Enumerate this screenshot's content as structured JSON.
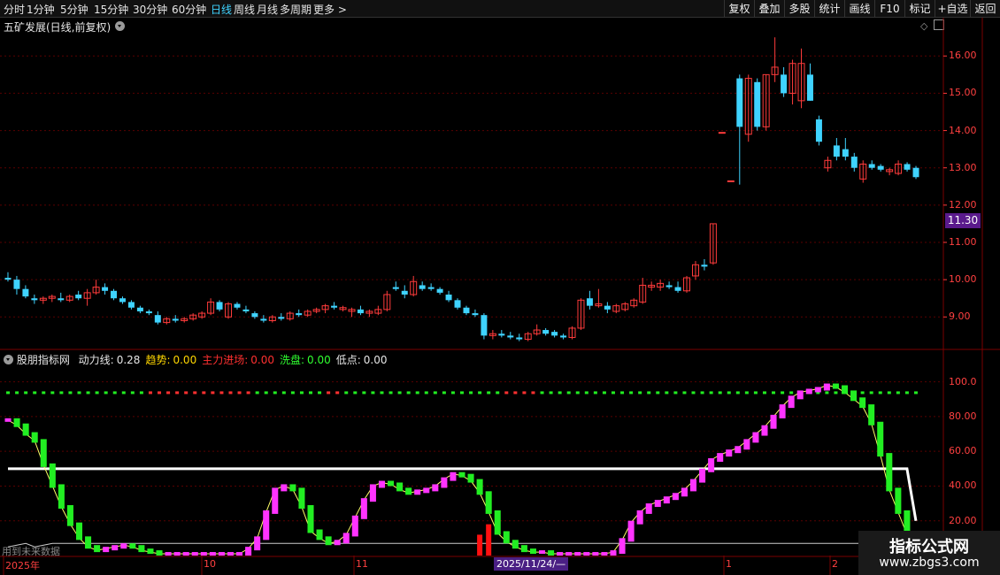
{
  "toolbar": {
    "timeframes": [
      {
        "label": "分时",
        "active": false
      },
      {
        "label": "1分钟",
        "active": false
      },
      {
        "label": "5分钟",
        "active": false
      },
      {
        "label": "15分钟",
        "active": false
      },
      {
        "label": "30分钟",
        "active": false
      },
      {
        "label": "60分钟",
        "active": false
      },
      {
        "label": "日线",
        "active": true
      },
      {
        "label": "周线",
        "active": false
      },
      {
        "label": "月线",
        "active": false
      },
      {
        "label": "多周期",
        "active": false
      },
      {
        "label": "更多 >",
        "active": false
      }
    ],
    "buttons": [
      "复权",
      "叠加",
      "多股",
      "统计",
      "画线",
      "F10",
      "标记",
      "+自选",
      "返回"
    ]
  },
  "main_panel": {
    "title": "五矿发展(日线,前复权)",
    "y_labels": [
      "16.00",
      "15.00",
      "14.00",
      "13.00",
      "12.00",
      "11.00",
      "10.00",
      "9.00"
    ],
    "current_price": "11.30"
  },
  "indicator_panel": {
    "name": "股朋指标网",
    "fields": [
      {
        "label": "动力线:",
        "value": "0.28",
        "label_color": "#e6e6e6",
        "value_color": "#e6e6e6"
      },
      {
        "label": "趋势:",
        "value": "0.00",
        "label_color": "#ffd700",
        "value_color": "#ffd700"
      },
      {
        "label": "主力进场:",
        "value": "0.00",
        "label_color": "#ff3030",
        "value_color": "#ff3030"
      },
      {
        "label": "洗盘:",
        "value": "0.00",
        "label_color": "#30ff30",
        "value_color": "#30ff30"
      },
      {
        "label": "低点:",
        "value": "0.00",
        "label_color": "#e6e6e6",
        "value_color": "#e6e6e6"
      }
    ],
    "y_labels": [
      "100.0",
      "80.00",
      "60.00",
      "40.00",
      "20.00"
    ]
  },
  "x_axis": {
    "labels": [
      {
        "text": "2025年"
      },
      {
        "text": "10"
      },
      {
        "text": "11"
      },
      {
        "text": "1"
      },
      {
        "text": "2"
      }
    ],
    "cursor_date": "2025/11/24/—"
  },
  "watermark": {
    "left_text": "用到未来数据",
    "brand": "指标公式网",
    "url": "www.zbgs3.com"
  },
  "colors": {
    "up": "#ff3b3b",
    "down": "#3fd3ff",
    "grid": "#7a0000",
    "accent": "#5a1a8c",
    "magenta": "#ff33ff",
    "green": "#22ee22"
  },
  "chart_data": [
    {
      "type": "candlestick",
      "y_range": [
        8.2,
        16.6
      ],
      "candles": [
        {
          "o": 10.05,
          "h": 10.2,
          "l": 9.95,
          "c": 10.0
        },
        {
          "o": 10.0,
          "h": 10.1,
          "l": 9.6,
          "c": 9.75
        },
        {
          "o": 9.75,
          "h": 9.85,
          "l": 9.5,
          "c": 9.55
        },
        {
          "o": 9.5,
          "h": 9.6,
          "l": 9.35,
          "c": 9.45
        },
        {
          "o": 9.45,
          "h": 9.55,
          "l": 9.35,
          "c": 9.5
        },
        {
          "o": 9.5,
          "h": 9.6,
          "l": 9.4,
          "c": 9.55
        },
        {
          "o": 9.5,
          "h": 9.65,
          "l": 9.4,
          "c": 9.45
        },
        {
          "o": 9.45,
          "h": 9.6,
          "l": 9.4,
          "c": 9.55
        },
        {
          "o": 9.6,
          "h": 9.7,
          "l": 9.45,
          "c": 9.5
        },
        {
          "o": 9.5,
          "h": 9.75,
          "l": 9.3,
          "c": 9.65
        },
        {
          "o": 9.65,
          "h": 10.0,
          "l": 9.6,
          "c": 9.8
        },
        {
          "o": 9.8,
          "h": 9.9,
          "l": 9.6,
          "c": 9.7
        },
        {
          "o": 9.7,
          "h": 9.75,
          "l": 9.45,
          "c": 9.5
        },
        {
          "o": 9.5,
          "h": 9.55,
          "l": 9.35,
          "c": 9.4
        },
        {
          "o": 9.4,
          "h": 9.45,
          "l": 9.2,
          "c": 9.25
        },
        {
          "o": 9.25,
          "h": 9.3,
          "l": 9.1,
          "c": 9.15
        },
        {
          "o": 9.15,
          "h": 9.2,
          "l": 9.05,
          "c": 9.1
        },
        {
          "o": 9.05,
          "h": 9.15,
          "l": 8.8,
          "c": 8.85
        },
        {
          "o": 8.85,
          "h": 9.0,
          "l": 8.8,
          "c": 8.95
        },
        {
          "o": 8.95,
          "h": 9.05,
          "l": 8.85,
          "c": 8.9
        },
        {
          "o": 8.9,
          "h": 9.0,
          "l": 8.85,
          "c": 8.95
        },
        {
          "o": 8.95,
          "h": 9.1,
          "l": 8.9,
          "c": 9.05
        },
        {
          "o": 9.0,
          "h": 9.15,
          "l": 8.95,
          "c": 9.1
        },
        {
          "o": 9.1,
          "h": 9.5,
          "l": 9.05,
          "c": 9.4
        },
        {
          "o": 9.4,
          "h": 9.45,
          "l": 9.15,
          "c": 9.2
        },
        {
          "o": 9.0,
          "h": 9.4,
          "l": 8.95,
          "c": 9.35
        },
        {
          "o": 9.35,
          "h": 9.4,
          "l": 9.2,
          "c": 9.25
        },
        {
          "o": 9.2,
          "h": 9.3,
          "l": 9.1,
          "c": 9.15
        },
        {
          "o": 9.1,
          "h": 9.15,
          "l": 8.95,
          "c": 9.0
        },
        {
          "o": 8.95,
          "h": 9.05,
          "l": 8.85,
          "c": 8.9
        },
        {
          "o": 8.9,
          "h": 9.05,
          "l": 8.85,
          "c": 9.0
        },
        {
          "o": 9.0,
          "h": 9.1,
          "l": 8.9,
          "c": 8.95
        },
        {
          "o": 8.95,
          "h": 9.15,
          "l": 8.9,
          "c": 9.1
        },
        {
          "o": 9.1,
          "h": 9.2,
          "l": 9.0,
          "c": 9.05
        },
        {
          "o": 9.05,
          "h": 9.2,
          "l": 9.0,
          "c": 9.15
        },
        {
          "o": 9.15,
          "h": 9.25,
          "l": 9.1,
          "c": 9.2
        },
        {
          "o": 9.2,
          "h": 9.35,
          "l": 9.1,
          "c": 9.3
        },
        {
          "o": 9.3,
          "h": 9.4,
          "l": 9.2,
          "c": 9.25
        },
        {
          "o": 9.2,
          "h": 9.3,
          "l": 9.15,
          "c": 9.25
        },
        {
          "o": 9.15,
          "h": 9.25,
          "l": 9.0,
          "c": 9.2
        },
        {
          "o": 9.2,
          "h": 9.3,
          "l": 9.05,
          "c": 9.1
        },
        {
          "o": 9.1,
          "h": 9.2,
          "l": 9.0,
          "c": 9.15
        },
        {
          "o": 9.1,
          "h": 9.3,
          "l": 9.05,
          "c": 9.2
        },
        {
          "o": 9.2,
          "h": 9.7,
          "l": 9.15,
          "c": 9.6
        },
        {
          "o": 9.8,
          "h": 9.95,
          "l": 9.7,
          "c": 9.75
        },
        {
          "o": 9.7,
          "h": 9.85,
          "l": 9.5,
          "c": 9.6
        },
        {
          "o": 9.6,
          "h": 10.1,
          "l": 9.55,
          "c": 9.95
        },
        {
          "o": 9.85,
          "h": 9.95,
          "l": 9.7,
          "c": 9.75
        },
        {
          "o": 9.8,
          "h": 9.9,
          "l": 9.7,
          "c": 9.75
        },
        {
          "o": 9.75,
          "h": 9.8,
          "l": 9.6,
          "c": 9.65
        },
        {
          "o": 9.6,
          "h": 9.7,
          "l": 9.4,
          "c": 9.45
        },
        {
          "o": 9.45,
          "h": 9.5,
          "l": 9.2,
          "c": 9.25
        },
        {
          "o": 9.25,
          "h": 9.3,
          "l": 9.05,
          "c": 9.1
        },
        {
          "o": 9.1,
          "h": 9.2,
          "l": 9.0,
          "c": 9.05
        },
        {
          "o": 9.05,
          "h": 9.1,
          "l": 8.4,
          "c": 8.5
        },
        {
          "o": 8.5,
          "h": 8.65,
          "l": 8.4,
          "c": 8.55
        },
        {
          "o": 8.55,
          "h": 8.65,
          "l": 8.45,
          "c": 8.5
        },
        {
          "o": 8.5,
          "h": 8.6,
          "l": 8.4,
          "c": 8.45
        },
        {
          "o": 8.45,
          "h": 8.55,
          "l": 8.35,
          "c": 8.4
        },
        {
          "o": 8.4,
          "h": 8.6,
          "l": 8.35,
          "c": 8.55
        },
        {
          "o": 8.55,
          "h": 8.8,
          "l": 8.5,
          "c": 8.65
        },
        {
          "o": 8.65,
          "h": 8.7,
          "l": 8.5,
          "c": 8.55
        },
        {
          "o": 8.6,
          "h": 8.65,
          "l": 8.45,
          "c": 8.5
        },
        {
          "o": 8.5,
          "h": 8.55,
          "l": 8.4,
          "c": 8.45
        },
        {
          "o": 8.45,
          "h": 8.75,
          "l": 8.4,
          "c": 8.7
        },
        {
          "o": 8.7,
          "h": 9.5,
          "l": 8.65,
          "c": 9.45
        },
        {
          "o": 9.5,
          "h": 9.7,
          "l": 9.2,
          "c": 9.3
        },
        {
          "o": 9.3,
          "h": 9.75,
          "l": 9.25,
          "c": 9.35
        },
        {
          "o": 9.3,
          "h": 9.4,
          "l": 9.1,
          "c": 9.2
        },
        {
          "o": 9.15,
          "h": 9.35,
          "l": 9.1,
          "c": 9.3
        },
        {
          "o": 9.2,
          "h": 9.4,
          "l": 9.15,
          "c": 9.35
        },
        {
          "o": 9.3,
          "h": 9.5,
          "l": 9.25,
          "c": 9.45
        },
        {
          "o": 9.4,
          "h": 10.05,
          "l": 9.35,
          "c": 9.85
        },
        {
          "o": 9.8,
          "h": 9.95,
          "l": 9.7,
          "c": 9.85
        },
        {
          "o": 9.8,
          "h": 10.0,
          "l": 9.7,
          "c": 9.9
        },
        {
          "o": 9.85,
          "h": 9.95,
          "l": 9.75,
          "c": 9.8
        },
        {
          "o": 9.8,
          "h": 9.95,
          "l": 9.65,
          "c": 9.7
        },
        {
          "o": 9.7,
          "h": 10.1,
          "l": 9.65,
          "c": 10.05
        },
        {
          "o": 10.1,
          "h": 10.5,
          "l": 10.0,
          "c": 10.4
        },
        {
          "o": 10.4,
          "h": 10.55,
          "l": 10.25,
          "c": 10.35
        },
        {
          "o": 10.45,
          "h": 11.5,
          "l": 10.4,
          "c": 11.5
        },
        {
          "o": 13.95,
          "h": 13.95,
          "l": 13.95,
          "c": 13.95
        },
        {
          "o": 12.65,
          "h": 12.65,
          "l": 12.65,
          "c": 12.65
        },
        {
          "o": 15.4,
          "h": 15.5,
          "l": 12.55,
          "c": 14.1
        },
        {
          "o": 13.9,
          "h": 15.5,
          "l": 13.7,
          "c": 15.4
        },
        {
          "o": 15.3,
          "h": 15.4,
          "l": 14.0,
          "c": 14.1
        },
        {
          "o": 14.1,
          "h": 15.5,
          "l": 14.0,
          "c": 15.5
        },
        {
          "o": 15.5,
          "h": 16.5,
          "l": 15.3,
          "c": 15.7
        },
        {
          "o": 15.5,
          "h": 15.7,
          "l": 14.9,
          "c": 15.0
        },
        {
          "o": 15.0,
          "h": 15.9,
          "l": 14.7,
          "c": 15.8
        },
        {
          "o": 14.8,
          "h": 16.2,
          "l": 14.6,
          "c": 15.8
        },
        {
          "o": 15.5,
          "h": 15.8,
          "l": 14.8,
          "c": 14.8
        },
        {
          "o": 14.3,
          "h": 14.4,
          "l": 13.6,
          "c": 13.7
        },
        {
          "o": 13.0,
          "h": 13.3,
          "l": 12.9,
          "c": 13.2
        },
        {
          "o": 13.6,
          "h": 13.8,
          "l": 13.2,
          "c": 13.3
        },
        {
          "o": 13.5,
          "h": 13.8,
          "l": 13.2,
          "c": 13.3
        },
        {
          "o": 13.3,
          "h": 13.4,
          "l": 12.9,
          "c": 13.0
        },
        {
          "o": 12.7,
          "h": 13.2,
          "l": 12.6,
          "c": 13.1
        },
        {
          "o": 13.1,
          "h": 13.2,
          "l": 12.95,
          "c": 13.0
        },
        {
          "o": 13.05,
          "h": 13.1,
          "l": 12.9,
          "c": 12.95
        },
        {
          "o": 12.9,
          "h": 13.0,
          "l": 12.8,
          "c": 12.95
        },
        {
          "o": 12.85,
          "h": 13.2,
          "l": 12.8,
          "c": 13.1
        },
        {
          "o": 13.1,
          "h": 13.15,
          "l": 12.9,
          "c": 12.95
        },
        {
          "o": 13.0,
          "h": 13.05,
          "l": 12.7,
          "c": 12.75
        }
      ]
    },
    {
      "type": "bar",
      "y_range": [
        0,
        110
      ],
      "values": [
        78,
        75,
        70,
        66,
        52,
        40,
        28,
        18,
        10,
        5,
        3,
        4,
        5,
        6,
        5,
        3,
        2,
        1,
        1,
        1,
        1,
        1,
        1,
        1,
        1,
        1,
        1,
        4,
        10,
        25,
        38,
        40,
        38,
        28,
        14,
        10,
        7,
        8,
        12,
        22,
        32,
        40,
        42,
        41,
        38,
        36,
        37,
        38,
        40,
        44,
        47,
        46,
        43,
        36,
        25,
        13,
        8,
        5,
        3,
        2,
        2,
        1,
        1,
        1,
        1,
        1,
        1,
        1,
        2,
        9,
        19,
        25,
        29,
        31,
        33,
        35,
        38,
        43,
        49,
        55,
        58,
        60,
        62,
        66,
        70,
        74,
        80,
        86,
        91,
        94,
        95,
        96,
        98,
        97,
        94,
        90,
        86,
        76,
        58,
        38,
        25,
        12,
        5
      ],
      "hist_values": [
        5,
        6,
        7,
        5,
        6,
        7,
        7,
        7,
        7,
        7,
        7,
        7,
        7,
        7,
        7,
        7,
        7,
        7,
        7,
        7,
        7,
        7,
        7,
        7,
        7,
        7,
        7,
        7,
        7,
        7,
        7,
        7,
        7,
        7,
        7,
        7,
        7,
        7,
        7,
        7,
        7,
        7,
        7,
        7,
        7,
        7,
        7,
        7,
        7,
        7,
        7,
        7,
        7,
        7,
        7,
        7,
        7,
        7,
        7,
        7,
        7,
        7,
        7,
        7,
        7,
        7,
        7,
        7,
        7,
        7,
        7,
        7,
        7,
        7,
        7,
        7,
        7,
        7,
        7,
        7,
        7,
        7,
        7,
        7,
        7,
        7,
        7,
        7,
        7,
        7,
        7,
        7,
        7,
        7,
        7,
        7,
        7,
        7,
        7,
        7,
        7,
        7,
        7
      ],
      "red_bars": [
        {
          "index": 53,
          "value": 12
        },
        {
          "index": 54,
          "value": 18
        }
      ],
      "white_line": [
        [
          0,
          50
        ],
        [
          101,
          50
        ],
        [
          102,
          20
        ]
      ]
    }
  ]
}
